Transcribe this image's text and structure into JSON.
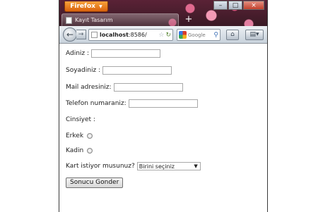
{
  "browser": {
    "menu_button": "Firefox",
    "menu_arrow": "▼",
    "window_controls": {
      "minimize": "–",
      "maximize": "□",
      "close": "×"
    },
    "tab_title": "Kayıt Tasarım",
    "new_tab": "+",
    "url_host": "localhost",
    "url_rest": ":8586/",
    "search_placeholder": "Google",
    "icons": {
      "back": "back-arrow-icon",
      "forward": "forward-arrow-icon",
      "star": "star-icon",
      "reload": "reload-icon",
      "home": "home-icon",
      "tools": "tools-menu-icon"
    }
  },
  "form": {
    "first_name_label": "Adiniz :",
    "last_name_label": "Soyadiniz :",
    "email_label": "Mail adresiniz:",
    "phone_label": "Telefon numaraniz:",
    "gender_label": "Cinsiyet :",
    "male_label": "Erkek",
    "female_label": "Kadin",
    "card_label": "Kart istiyor musunuz?",
    "card_select_value": "Birini seçiniz",
    "submit_label": "Sonucu Gonder",
    "first_name_value": "",
    "last_name_value": "",
    "email_value": "",
    "phone_value": ""
  }
}
